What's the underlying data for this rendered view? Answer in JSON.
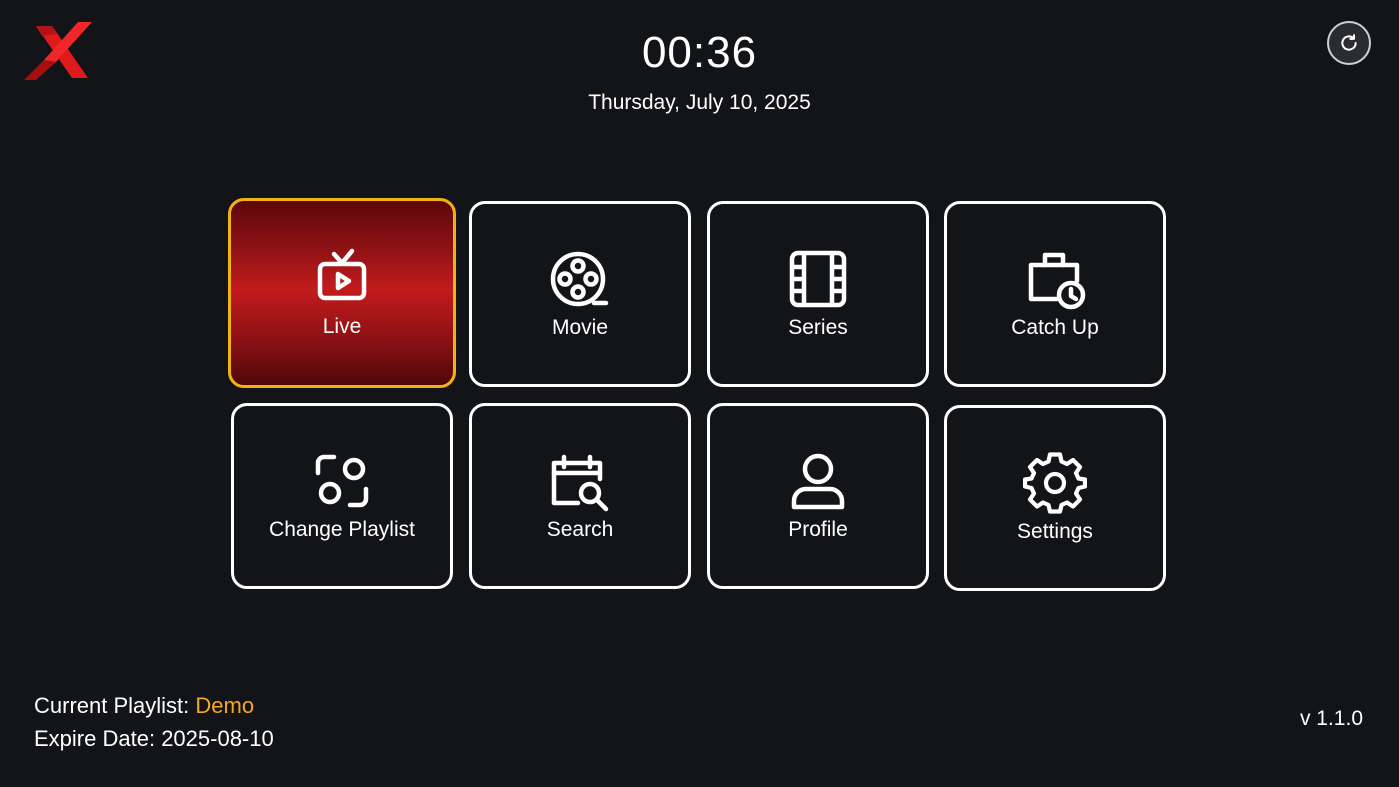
{
  "app": {
    "logo": "x-logo"
  },
  "header": {
    "time": "00:36",
    "date": "Thursday, July 10, 2025",
    "refresh_icon": "refresh-icon"
  },
  "menu": {
    "tiles": [
      {
        "label": "Live",
        "icon": "tv-icon",
        "active": true
      },
      {
        "label": "Movie",
        "icon": "film-reel-icon",
        "active": false
      },
      {
        "label": "Series",
        "icon": "film-strip-icon",
        "active": false
      },
      {
        "label": "Catch Up",
        "icon": "catch-up-clock-icon",
        "active": false
      },
      {
        "label": "Change Playlist",
        "icon": "change-playlist-icon",
        "active": false
      },
      {
        "label": "Search",
        "icon": "calendar-search-icon",
        "active": false
      },
      {
        "label": "Profile",
        "icon": "user-icon",
        "active": false
      },
      {
        "label": "Settings",
        "icon": "gear-icon",
        "active": false
      }
    ]
  },
  "footer": {
    "playlist_label": "Current Playlist:",
    "playlist_value": "Demo",
    "expire_label": "Expire Date:",
    "expire_value": "2025-08-10",
    "version": "v 1.1.0"
  },
  "colors": {
    "background": "#131418",
    "active_border": "#f2b310",
    "active_fill": "#c21b1c",
    "accent_text": "#f5a623",
    "logo_red": "#e11d1d"
  }
}
